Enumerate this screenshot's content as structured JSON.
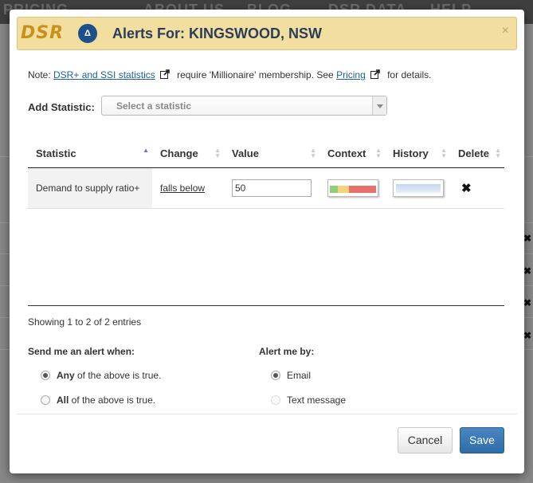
{
  "background": {
    "nav_items": [
      "PRICING",
      "ABOUT US",
      "BLOG",
      "DSR DATA",
      "HELP"
    ]
  },
  "modal": {
    "logo_text": "DSR",
    "title": "Alerts For: KINGSWOOD, NSW",
    "close_glyph": "×",
    "note": {
      "prefix": "Note: ",
      "link1": "DSR+ and SSI statistics",
      "middle": " require 'Millionaire' membership. See ",
      "link2": "Pricing",
      "suffix": " for details."
    },
    "add_statistic": {
      "label": "Add Statistic:",
      "placeholder": "Select a statistic"
    },
    "table": {
      "columns": [
        "Statistic",
        "Change",
        "Value",
        "Context",
        "History",
        "Delete"
      ],
      "rows": [
        {
          "statistic": "Demand to supply ratio+",
          "change": "falls below",
          "value": "50",
          "delete_glyph": "✖"
        }
      ],
      "info": "Showing 1 to 2 of 2 entries"
    },
    "send_alert": {
      "label": "Send me an alert when:",
      "options": [
        {
          "strong": "Any",
          "rest": " of the above is true.",
          "checked": true
        },
        {
          "strong": "All",
          "rest": " of the above is true.",
          "checked": false
        }
      ]
    },
    "alert_by": {
      "label": "Alert me by:",
      "options": [
        {
          "label": "Email",
          "checked": true,
          "enabled": true
        },
        {
          "label": "Text message",
          "checked": false,
          "enabled": false
        }
      ]
    },
    "buttons": {
      "cancel": "Cancel",
      "save": "Save"
    },
    "colors": {
      "header_bg": "#f2dfa0",
      "title": "#2a3d5a",
      "save_bg": "#2e6da8",
      "sort_active": "#6a6fd4"
    }
  }
}
